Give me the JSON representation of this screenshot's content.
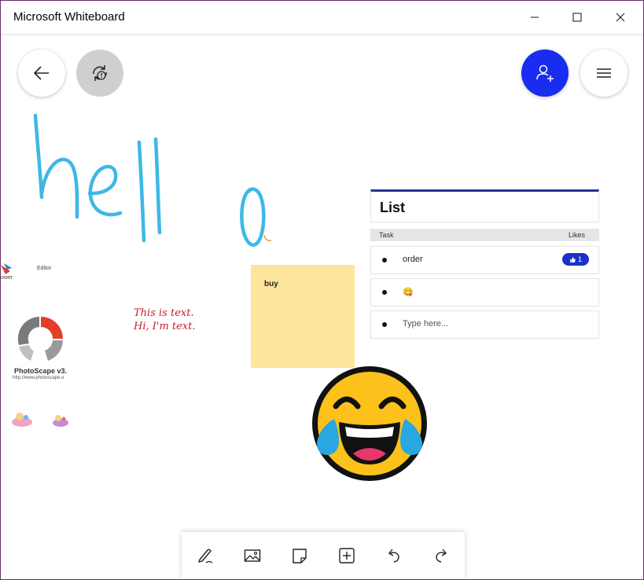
{
  "window": {
    "title": "Microsoft Whiteboard"
  },
  "ink": {
    "text": "hello",
    "color": "#3db8e6"
  },
  "list": {
    "title": "List",
    "columns": {
      "task": "Task",
      "likes": "Likes"
    },
    "items": [
      {
        "text": "order",
        "likes": "1"
      },
      {
        "text": "😋",
        "likes": null
      },
      {
        "placeholder": "Type here..."
      }
    ]
  },
  "sticky_note": {
    "text": "buy",
    "color": "#fde59d"
  },
  "text_note": {
    "line1": "This is text.",
    "line2": "Hi, I'm text.",
    "color": "#c42030"
  },
  "images": {
    "photoscape_label": "PhotoScape v3.",
    "photoscape_url": "http://www.photoscape.o",
    "editor_label": "Editor",
    "ower_label": "ower"
  },
  "colors": {
    "accent": "#1a2cf0",
    "list_border": "#22349a"
  }
}
